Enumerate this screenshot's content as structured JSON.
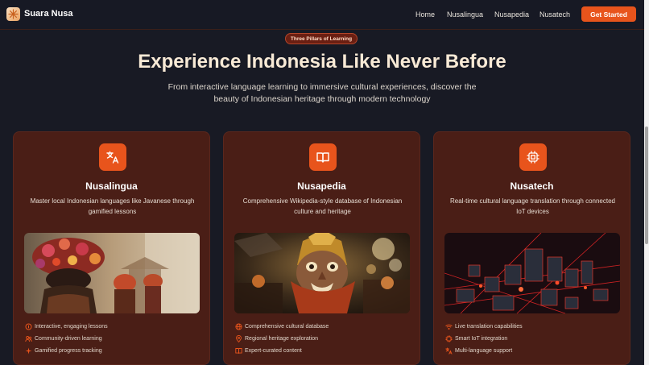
{
  "nav": {
    "brand": "Suara Nusa",
    "links": [
      "Home",
      "Nusalingua",
      "Nusapedia",
      "Nusatech"
    ],
    "cta": "Get Started"
  },
  "hero": {
    "badge": "Three Pillars of Learning",
    "title": "Experience Indonesia Like Never Before",
    "subtitle": "From interactive language learning to immersive cultural experiences, discover the beauty of Indonesian heritage through modern technology"
  },
  "cards": [
    {
      "icon": "translate-icon",
      "title": "Nusalingua",
      "description": "Master local Indonesian languages like Javanese through gamified lessons",
      "image": "dancers-floral-headdress-image",
      "features": [
        {
          "icon": "coin-icon",
          "label": "Interactive, engaging lessons"
        },
        {
          "icon": "users-icon",
          "label": "Community-driven learning"
        },
        {
          "icon": "sparkle-icon",
          "label": "Gamified progress tracking"
        }
      ]
    },
    {
      "icon": "book-open-icon",
      "title": "Nusapedia",
      "description": "Comprehensive Wikipedia-style database of Indonesian culture and heritage",
      "image": "barong-mask-image",
      "features": [
        {
          "icon": "globe-icon",
          "label": "Comprehensive cultural database"
        },
        {
          "icon": "map-pin-icon",
          "label": "Regional heritage exploration"
        },
        {
          "icon": "book-icon",
          "label": "Expert-curated content"
        }
      ]
    },
    {
      "icon": "chip-icon",
      "title": "Nusatech",
      "description": "Real-time cultural language translation through connected IoT devices",
      "image": "iot-circuit-city-image",
      "features": [
        {
          "icon": "wifi-icon",
          "label": "Live translation capabilities"
        },
        {
          "icon": "chip-small-icon",
          "label": "Smart IoT integration"
        },
        {
          "icon": "translate-small-icon",
          "label": "Multi-language support"
        }
      ]
    }
  ],
  "colors": {
    "accent": "#e8541c",
    "card_bg": "#4a1e16",
    "page_bg": "#181a24"
  }
}
